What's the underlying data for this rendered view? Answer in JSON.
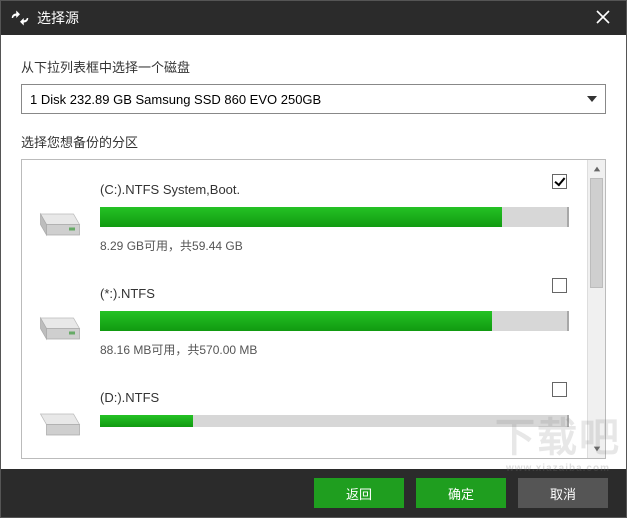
{
  "titlebar": {
    "title": "选择源"
  },
  "labelDisk": "从下拉列表框中选择一个磁盘",
  "dropdown": {
    "selected": "1 Disk 232.89 GB Samsung SSD 860 EVO 250GB"
  },
  "labelPart": "选择您想备份的分区",
  "partitions": [
    {
      "name": "(C:).NTFS System,Boot.",
      "usedPct": 86,
      "stat": "8.29 GB可用，共59.44 GB",
      "checked": true
    },
    {
      "name": "(*:).NTFS",
      "usedPct": 84,
      "stat": "88.16 MB可用，共570.00 MB",
      "checked": false
    },
    {
      "name": "(D:).NTFS",
      "usedPct": 20,
      "stat": "",
      "checked": false
    }
  ],
  "buttons": {
    "back": "返回",
    "ok": "确定",
    "cancel": "取消"
  },
  "watermark": {
    "big": "下载吧",
    "small": "www.xiazaiba.com"
  }
}
